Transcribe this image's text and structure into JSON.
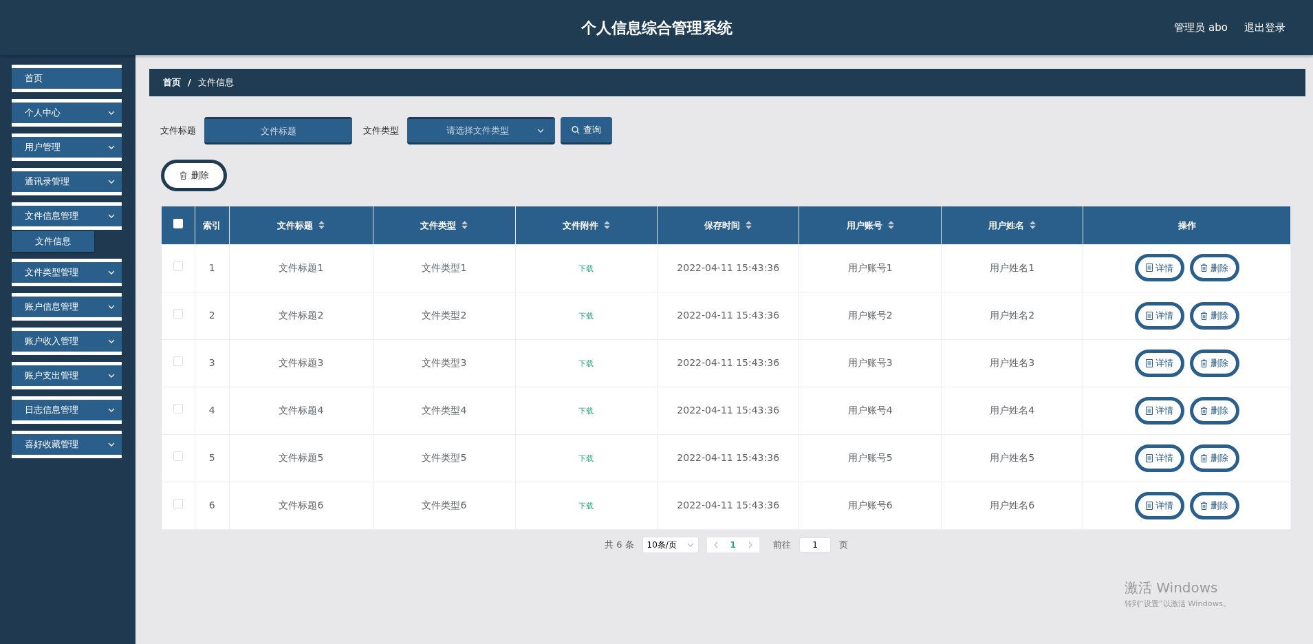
{
  "header": {
    "title": "个人信息综合管理系统",
    "user": "管理员 abo",
    "logout": "退出登录"
  },
  "sidebar": {
    "items": [
      {
        "label": "首页",
        "expandable": false
      },
      {
        "label": "个人中心",
        "expandable": true
      },
      {
        "label": "用户管理",
        "expandable": true
      },
      {
        "label": "通讯录管理",
        "expandable": true
      },
      {
        "label": "文件信息管理",
        "expandable": true,
        "children": [
          {
            "label": "文件信息"
          }
        ]
      },
      {
        "label": "文件类型管理",
        "expandable": true
      },
      {
        "label": "账户信息管理",
        "expandable": true
      },
      {
        "label": "账户收入管理",
        "expandable": true
      },
      {
        "label": "账户支出管理",
        "expandable": true
      },
      {
        "label": "日志信息管理",
        "expandable": true
      },
      {
        "label": "喜好收藏管理",
        "expandable": true
      }
    ]
  },
  "breadcrumb": [
    "首页",
    "文件信息"
  ],
  "breadcrumb_separator": "/",
  "search": {
    "title_label": "文件标题",
    "title_placeholder": "文件标题",
    "type_label": "文件类型",
    "type_placeholder": "请选择文件类型",
    "query_button": "查询"
  },
  "delete_button": "删除",
  "table": {
    "select_all_checked": false,
    "columns": [
      {
        "label": "索引",
        "sortable": false
      },
      {
        "label": "文件标题",
        "sortable": true
      },
      {
        "label": "文件类型",
        "sortable": true
      },
      {
        "label": "文件附件",
        "sortable": true
      },
      {
        "label": "保存时间",
        "sortable": true
      },
      {
        "label": "用户账号",
        "sortable": true
      },
      {
        "label": "用户姓名",
        "sortable": true
      },
      {
        "label": "操作",
        "sortable": false
      }
    ],
    "rows": [
      {
        "checked": false,
        "index": "1",
        "title": "文件标题1",
        "type": "文件类型1",
        "attachment": "下载",
        "time": "2022-04-11 15:43:36",
        "account": "用户账号1",
        "name": "用户姓名1",
        "actions": [
          "详情",
          "删除"
        ]
      },
      {
        "checked": false,
        "index": "2",
        "title": "文件标题2",
        "type": "文件类型2",
        "attachment": "下载",
        "time": "2022-04-11 15:43:36",
        "account": "用户账号2",
        "name": "用户姓名2",
        "actions": [
          "详情",
          "删除"
        ]
      },
      {
        "checked": false,
        "index": "3",
        "title": "文件标题3",
        "type": "文件类型3",
        "attachment": "下载",
        "time": "2022-04-11 15:43:36",
        "account": "用户账号3",
        "name": "用户姓名3",
        "actions": [
          "详情",
          "删除"
        ]
      },
      {
        "checked": false,
        "index": "4",
        "title": "文件标题4",
        "type": "文件类型4",
        "attachment": "下载",
        "time": "2022-04-11 15:43:36",
        "account": "用户账号4",
        "name": "用户姓名4",
        "actions": [
          "详情",
          "删除"
        ]
      },
      {
        "checked": false,
        "index": "5",
        "title": "文件标题5",
        "type": "文件类型5",
        "attachment": "下载",
        "time": "2022-04-11 15:43:36",
        "account": "用户账号5",
        "name": "用户姓名5",
        "actions": [
          "详情",
          "删除"
        ]
      },
      {
        "checked": false,
        "index": "6",
        "title": "文件标题6",
        "type": "文件类型6",
        "attachment": "下载",
        "time": "2022-04-11 15:43:36",
        "account": "用户账号6",
        "name": "用户姓名6",
        "actions": [
          "详情",
          "删除"
        ]
      }
    ]
  },
  "pagination": {
    "total": "共 6 条",
    "page_size": "10条/页",
    "pages": [
      {
        "label": "1",
        "selected": true
      }
    ],
    "goto_label": "前往",
    "goto_value": "1",
    "goto_suffix": "页"
  },
  "os_notice": {
    "title": "激活 Windows",
    "text": "转到“设置”以激活 Windows。"
  }
}
